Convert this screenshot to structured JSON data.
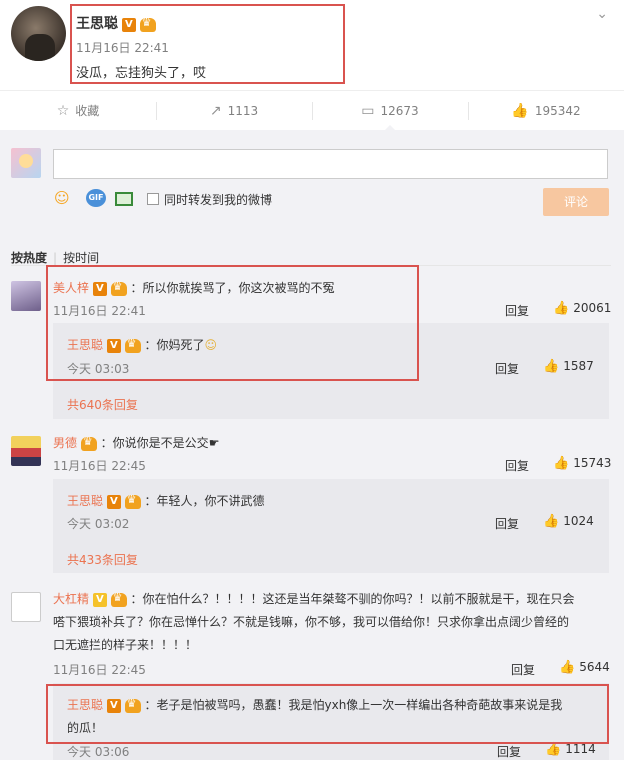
{
  "post": {
    "author": "王思聪",
    "time": "11月16日 22:41",
    "text": "没瓜，忘挂狗头了，哎"
  },
  "actions": {
    "favorite": "收藏",
    "repost_count": "1113",
    "comment_count": "12673",
    "like_count": "195342"
  },
  "composer": {
    "sync_label": "同时转发到我的微博",
    "submit_label": "评论"
  },
  "sort": {
    "hot": "按热度",
    "time": "按时间"
  },
  "comments": [
    {
      "author": "美人梓",
      "text": "：所以你就挨骂了，你这次被骂的不冤",
      "time": "11月16日 22:41",
      "reply": "回复",
      "likes": "20061",
      "sub": {
        "author": "王思聪",
        "text": "：你妈死了",
        "time": "今天 03:03",
        "reply": "回复",
        "likes": "1587"
      },
      "more": "共640条回复"
    },
    {
      "author": "男德",
      "text": "：你说你是不是公交",
      "time": "11月16日 22:45",
      "reply": "回复",
      "likes": "15743",
      "sub": {
        "author": "王思聪",
        "text": "：年轻人，你不讲武德",
        "time": "今天 03:02",
        "reply": "回复",
        "likes": "1024"
      },
      "more": "共433条回复"
    },
    {
      "author": "大杠精",
      "text1": "：你在怕什么？！！！！这还是当年桀骜不驯的你吗？！以前不服就是干，现在只会",
      "text2": "嗒下猥琐补兵了？你在忌惮什么？不就是钱嘛，你不够，我可以借给你！只求你拿出点阔少曾经的",
      "text3": "口无遮拦的样子来！！！！",
      "time": "11月16日 22:45",
      "reply": "回复",
      "likes": "5644",
      "sub": {
        "author": "王思聪",
        "text1": "：老子是怕被骂吗，愚蠢！我是怕yxh像上一次一样编出各种奇葩故事来说是我",
        "text2": "的瓜！",
        "time": "今天 03:06",
        "reply": "回复",
        "likes": "1114"
      }
    }
  ],
  "colors": {
    "name": "#eb7350",
    "highlight": "#d9534f",
    "submit": "#f7c7a0"
  }
}
